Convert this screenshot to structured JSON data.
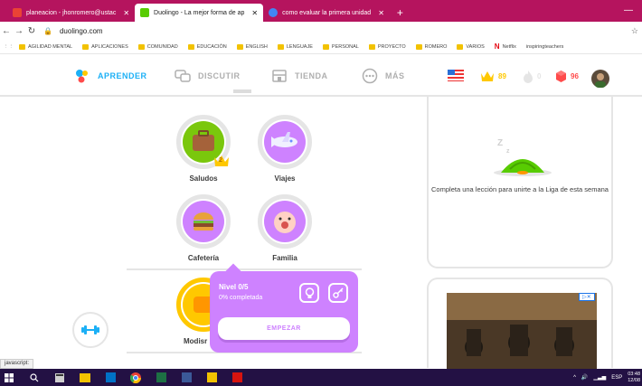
{
  "browser": {
    "tabs": [
      {
        "label": "planeacion - jhonromero@ustac",
        "color": "#ea4335"
      },
      {
        "label": "Duolingo - La mejor forma de ap",
        "color": "#58cc02"
      },
      {
        "label": "como evaluar la primera unidad",
        "color": "#4285f4"
      }
    ],
    "url": "duolingo.com",
    "bookmarks": [
      "AGILIDAD MENTAL",
      "APLICACIONES",
      "COMUNIDAD",
      "EDUCACIÓN",
      "ENGLISH",
      "LENGUAJE",
      "PERSONAL",
      "PROYECTO",
      "ROMERO",
      "VARIOS"
    ],
    "bookmark_netflix": "Netflix",
    "bookmark_last": "inspiringteachers"
  },
  "header": {
    "nav": [
      "APRENDER",
      "DISCUTIR",
      "TIENDA",
      "MÁS"
    ],
    "crowns": "89",
    "streak": "0",
    "gems": "96"
  },
  "skills": [
    {
      "name": "Saludos",
      "icon": "suitcase-icon",
      "color": "#7ac70c",
      "crown": "2"
    },
    {
      "name": "Viajes",
      "icon": "plane-icon",
      "color": "#ce82ff"
    },
    {
      "name": "Cafetería",
      "icon": "burger-icon",
      "color": "#ce82ff"
    },
    {
      "name": "Familia",
      "icon": "baby-icon",
      "color": "#ce82ff"
    },
    {
      "name": "Modisr",
      "icon": "modismos-icon",
      "color": "#ffc800"
    }
  ],
  "popup": {
    "level": "Nivel 0/5",
    "progress": "0% completada",
    "start": "EMPEZAR"
  },
  "league": {
    "text": "Completa una lección para unirte a la Liga de esta semana"
  },
  "status_text": "javascript:",
  "clock": {
    "time": "03:48",
    "date": "12/08"
  },
  "tray_lang": "ESP"
}
